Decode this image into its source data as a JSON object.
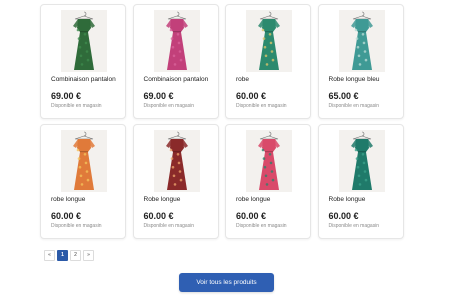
{
  "colors": {
    "accent": "#2f5fb3",
    "pagination_active": "#2b5aa8"
  },
  "products": [
    {
      "name": "Combinaison pantalon",
      "price": "69.00 €",
      "availability": "Disponible en magasin",
      "garment_color": "#2f6b3a",
      "pattern_color": "#3d8a4c"
    },
    {
      "name": "Combinaison pantalon",
      "price": "69.00 €",
      "availability": "Disponible en magasin",
      "garment_color": "#c2407a",
      "pattern_color": "#d8629a"
    },
    {
      "name": "robe",
      "price": "60.00 €",
      "availability": "Disponible en magasin",
      "garment_color": "#2c8a6e",
      "pattern_color": "#d9c26a"
    },
    {
      "name": "Robe longue bleu",
      "price": "65.00 €",
      "availability": "Disponible en magasin",
      "garment_color": "#3f9a95",
      "pattern_color": "#b5d9d3"
    },
    {
      "name": "robe longue",
      "price": "60.00 €",
      "availability": "Disponible en magasin",
      "garment_color": "#e07a3a",
      "pattern_color": "#f2c25a"
    },
    {
      "name": "Robe longue",
      "price": "60.00 €",
      "availability": "Disponible en magasin",
      "garment_color": "#8a2a2a",
      "pattern_color": "#e8a06a"
    },
    {
      "name": "robe longue",
      "price": "60.00 €",
      "availability": "Disponible en magasin",
      "garment_color": "#d94a6a",
      "pattern_color": "#2f7f6a"
    },
    {
      "name": "Robe longue",
      "price": "60.00 €",
      "availability": "Disponible en magasin",
      "garment_color": "#1f7a6a",
      "pattern_color": "#3aa08a"
    }
  ],
  "pagination": {
    "prev": "«",
    "pages": [
      "1",
      "2"
    ],
    "active_page": "1",
    "next": "»"
  },
  "cta": {
    "label": "Voir tous les produits"
  }
}
